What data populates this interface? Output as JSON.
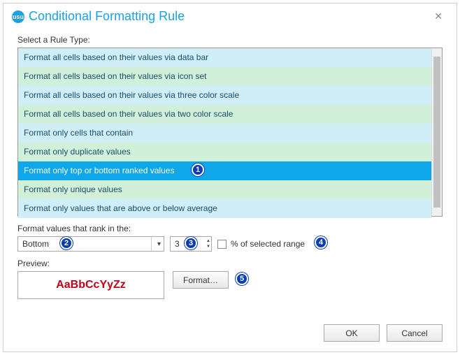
{
  "dialog": {
    "title": "Conditional Formatting Rule",
    "app_icon_text": "usu"
  },
  "sections": {
    "rule_type_label": "Select a Rule Type:",
    "rank_label": "Format values that rank in the:",
    "preview_label": "Preview:"
  },
  "rule_types": {
    "items": [
      "Format all cells based on their values via data bar",
      "Format all cells based on their values via icon set",
      "Format all cells based on their values via three color scale",
      "Format all cells based on their values via two color scale",
      "Format only cells that contain",
      "Format only duplicate values",
      "Format only top or bottom ranked values",
      "Format only unique values",
      "Format only values that are above or below average"
    ],
    "selected_index": 6
  },
  "edit": {
    "direction_value": "Bottom",
    "count_value": "3",
    "percent_checked": false,
    "percent_label": "% of selected range"
  },
  "buttons": {
    "format": "Format…",
    "ok": "OK",
    "cancel": "Cancel"
  },
  "preview": {
    "sample_text": "AaBbCcYyZz",
    "sample_color": "#c00018"
  },
  "callouts": [
    "1",
    "2",
    "3",
    "4",
    "5"
  ]
}
